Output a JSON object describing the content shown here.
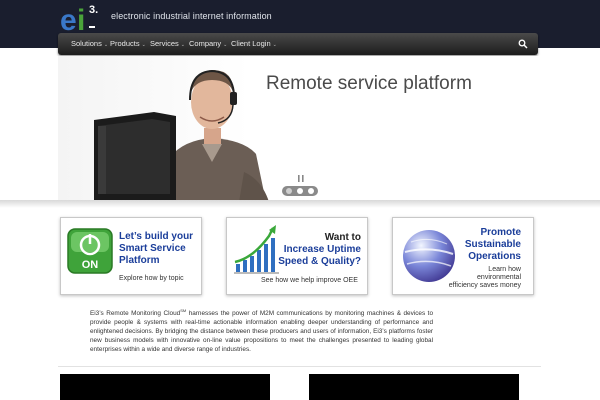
{
  "header": {
    "logo": {
      "e": "e",
      "i": "i",
      "superscript": "3."
    },
    "tagline": "electronic industrial internet information"
  },
  "nav": {
    "items": [
      {
        "label": "Solutions",
        "has_dropdown": true
      },
      {
        "label": "Products",
        "has_dropdown": true
      },
      {
        "label": "Services",
        "has_dropdown": true
      },
      {
        "label": "Company",
        "has_dropdown": true
      },
      {
        "label": "Client Login",
        "has_dropdown": true
      }
    ],
    "caret": "⌄",
    "search_icon": "search-icon"
  },
  "hero": {
    "title": "Remote service platform",
    "pause_label": "II",
    "slides": 3,
    "active_slide": 1
  },
  "features": [
    {
      "title_line1": "Let’s build your",
      "title_line2": "Smart Service",
      "title_line3": "Platform",
      "subtitle": "Explore how by topic",
      "icon": "power-on-icon",
      "icon_text": "ON"
    },
    {
      "title_line1": "Want to",
      "title_line2": "Increase Uptime",
      "title_line3": "Speed & Quality?",
      "subtitle": "See how we help improve OEE",
      "icon": "bar-chart-growth-icon"
    },
    {
      "title_line1": "Promote",
      "title_line2": "Sustainable",
      "title_line3": "Operations",
      "subtitle_line1": "Learn how",
      "subtitle_line2": "environmental",
      "subtitle_line3": "efficiency saves money",
      "icon": "globe-icon"
    }
  ],
  "body": {
    "lead": "Ei3’s Remote Monitoring Cloud",
    "sm": "SM",
    "rest": " harnesses the power of M2M communications by monitoring machines & devices to provide people & systems with real-time actionable information enabling deeper understanding of performance and enlightened decisions.   By bridging the distance between these producers and users of information, Ei3’s platforms foster new business models with innovative on-line value propositions to meet the  challenges presented to leading global enterprises within a wide and diverse range of industries."
  },
  "colors": {
    "header_bg": "#1a1e2e",
    "accent_blue": "#1b3e9a",
    "logo_blue": "#3a78c8",
    "logo_green": "#4aa33a"
  }
}
